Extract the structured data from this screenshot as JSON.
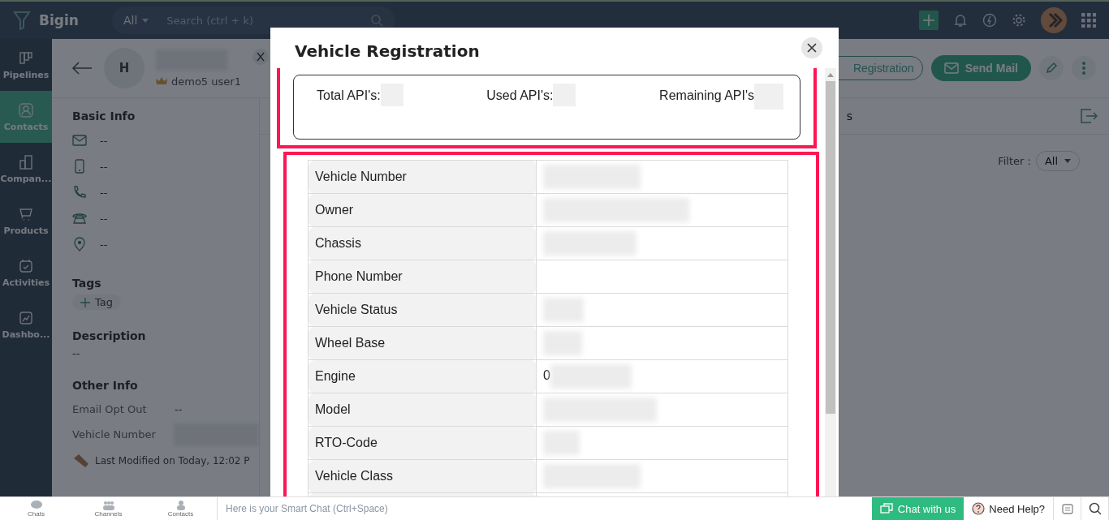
{
  "topbar": {
    "brand": "Bigin",
    "module_filter": "All",
    "search": {
      "placeholder": "Search (ctrl + k)"
    }
  },
  "sidebar": {
    "items": [
      {
        "label": "Pipelines",
        "selected": false
      },
      {
        "label": "Contacts",
        "selected": true
      },
      {
        "label": "Compan...",
        "selected": false
      },
      {
        "label": "Products",
        "selected": false
      },
      {
        "label": "Activities",
        "selected": false
      },
      {
        "label": "Dashbo...",
        "selected": false
      }
    ]
  },
  "contact": {
    "avatar_initial": "H",
    "owner": "demo5 user1",
    "actions": [
      "Registration",
      "Send Mail"
    ],
    "tab_fragment": "s"
  },
  "basic_info": {
    "title": "Basic Info",
    "fields": [
      {
        "value": "--"
      },
      {
        "value": "--"
      },
      {
        "value": "--"
      },
      {
        "value": "--"
      },
      {
        "value": "--"
      }
    ]
  },
  "tags": {
    "title": "Tags",
    "add_label": "Tag"
  },
  "description": {
    "title": "Description",
    "value": "--"
  },
  "other_info": {
    "title": "Other Info",
    "fields": [
      {
        "kind": "text",
        "label": "Email Opt Out",
        "value": "--"
      },
      {
        "kind": "redacted",
        "label": "Vehicle Number"
      }
    ]
  },
  "last_modified": "Last Modified on Today, 12:02 P",
  "filter": {
    "label": "Filter :",
    "value": "All"
  },
  "modal": {
    "title": "Vehicle Registration",
    "api_counts": [
      {
        "label": "Total API's:",
        "redacted": true
      },
      {
        "label": "Used API's:",
        "redacted": true
      },
      {
        "label": "Remaining API's",
        "redacted": true
      }
    ],
    "rows": [
      {
        "label": "Vehicle Number",
        "redacted": true
      },
      {
        "label": "Owner",
        "redacted": true
      },
      {
        "label": "Chassis",
        "redacted": true
      },
      {
        "label": "Phone Number"
      },
      {
        "label": "Vehicle Status",
        "redacted": true
      },
      {
        "label": "Wheel Base",
        "redacted": true
      },
      {
        "label": "Engine",
        "value": "0",
        "redacted": true
      },
      {
        "label": "Model",
        "redacted": true
      },
      {
        "label": "RTO-Code",
        "redacted": true
      },
      {
        "label": "Vehicle Class",
        "redacted": true
      }
    ]
  },
  "bottom_bar": {
    "tabs": [
      "Chats",
      "Channels",
      "Contacts"
    ],
    "smart_chat": {
      "placeholder": "Here is your Smart Chat (Ctrl+Space)"
    },
    "chat_button": "Chat with us",
    "help": "Need Help?"
  }
}
